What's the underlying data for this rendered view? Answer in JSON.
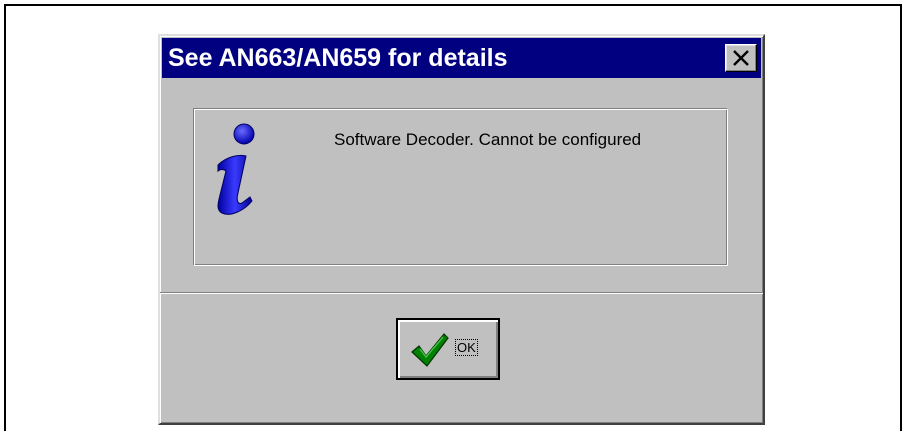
{
  "dialog": {
    "title": "See AN663/AN659 for details",
    "close_label": "X",
    "message": "Software Decoder.  Cannot be configured",
    "icon": "info-icon",
    "ok_button": {
      "icon": "checkmark-icon",
      "label": "OK"
    }
  },
  "colors": {
    "titlebar": "#000080",
    "face": "#c0c0c0",
    "info_icon": "#0000c0",
    "checkmark": "#008000"
  }
}
